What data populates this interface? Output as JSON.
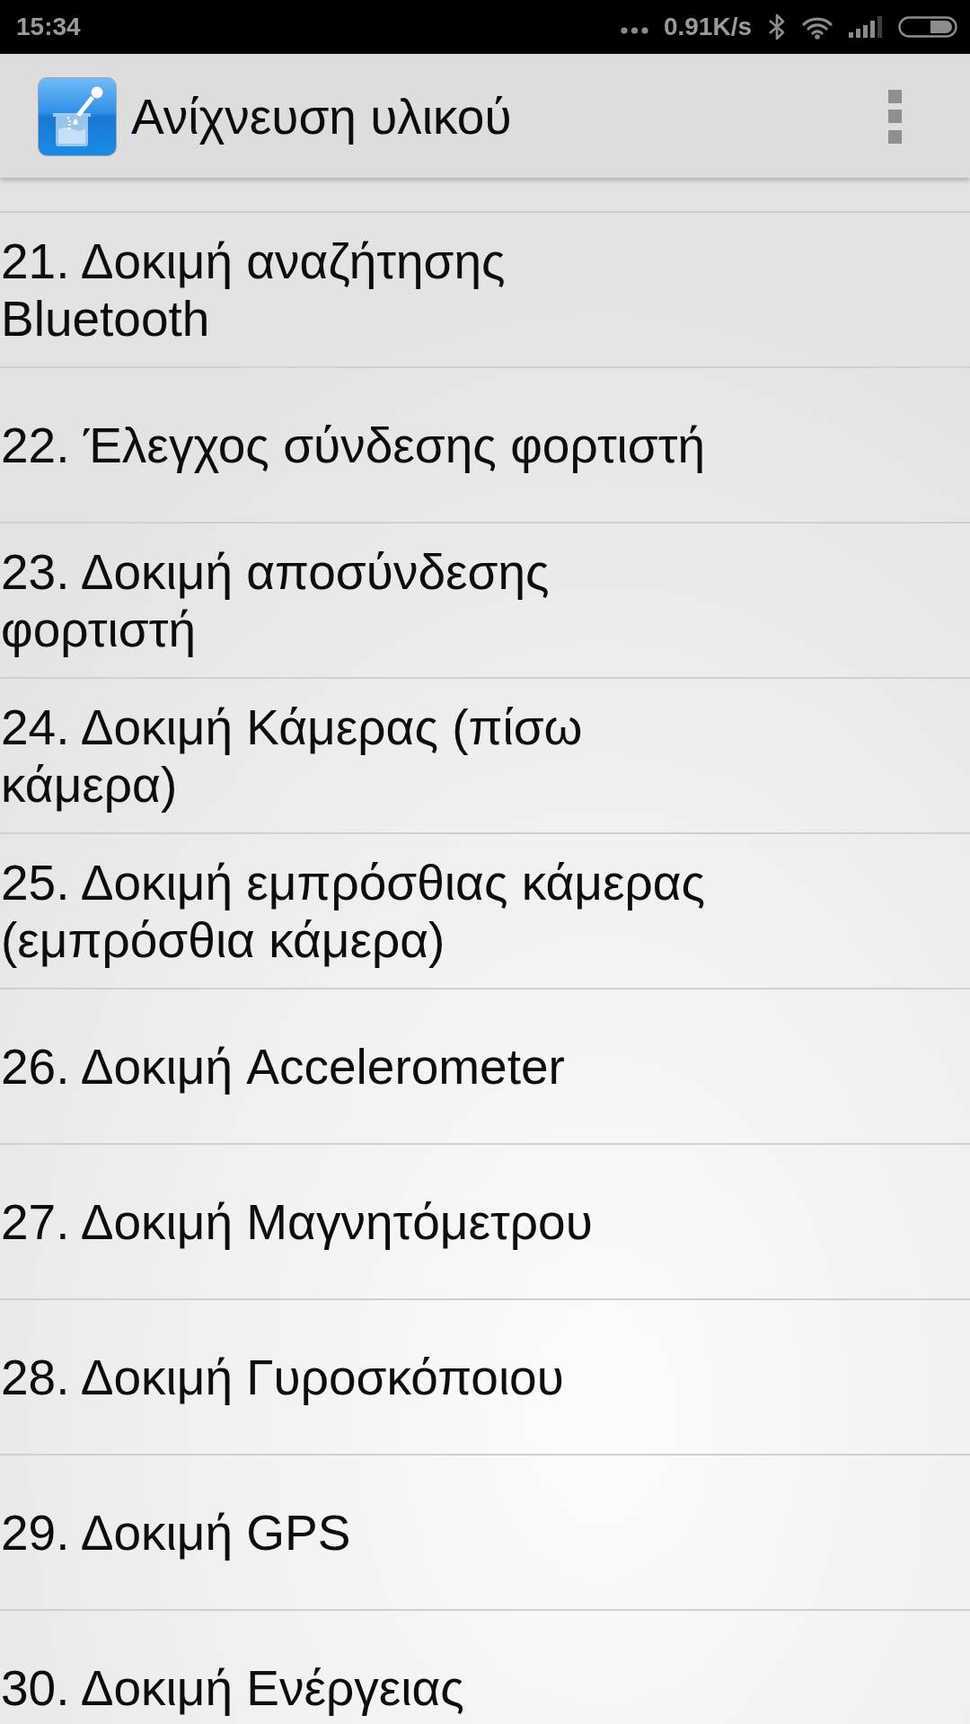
{
  "status_bar": {
    "time": "15:34",
    "network_speed": "0.91K/s"
  },
  "app_bar": {
    "title": "Ανίχνευση υλικού"
  },
  "list": {
    "items": [
      "21. Δοκιμή αναζήτησης Bluetooth",
      "22. Έλεγχος σύνδεσης φορτιστή",
      "23. Δοκιμή αποσύνδεσης φορτιστή",
      "24. Δοκιμή Κάμερας (πίσω κάμερα)",
      "25. Δοκιμή εμπρόσθιας κάμερας (εμπρόσθια κάμερα)",
      "26. Δοκιμή Accelerometer",
      "27. Δοκιμή Μαγνητόμετρου",
      "28. Δοκιμή Γυροσκόποιου",
      "29. Δοκιμή GPS",
      "30. Δοκιμή Ενέργειας"
    ]
  }
}
